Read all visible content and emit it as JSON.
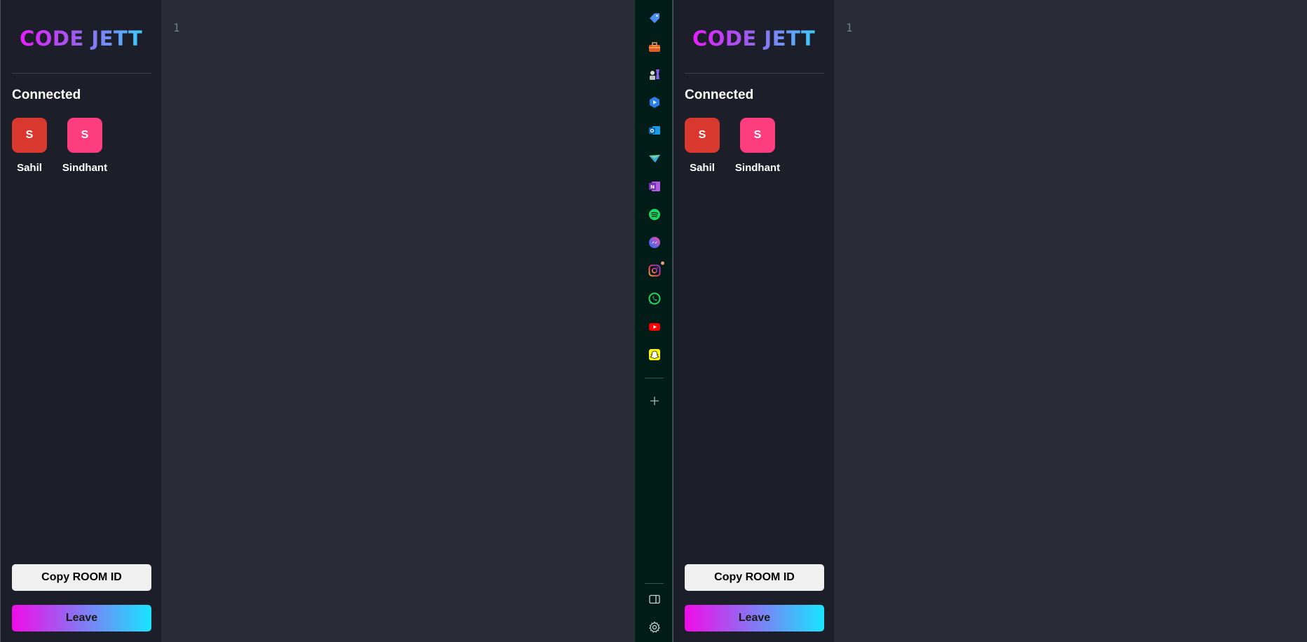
{
  "app": {
    "logo_text": "CODE JETT",
    "connected_label": "Connected",
    "clients": [
      {
        "initial": "S",
        "name": "Sahil",
        "color": "#d9382f"
      },
      {
        "initial": "S",
        "name": "Sindhant",
        "color": "#fe3d7e"
      }
    ],
    "copy_button": "Copy ROOM ID",
    "leave_button": "Leave",
    "line_number": "1",
    "brand_gradient": [
      "#e81cff",
      "#40c9ff"
    ]
  },
  "taskbar": {
    "icons": [
      "tag-icon",
      "toolbox-icon",
      "chess-icon",
      "copilot-icon",
      "outlook-icon",
      "send-anywhere-icon",
      "onenote-icon",
      "spotify-icon",
      "messenger-icon",
      "instagram-icon",
      "whatsapp-icon",
      "youtube-icon",
      "snapchat-icon",
      "add-icon",
      "sidebar-toggle-icon",
      "settings-icon"
    ]
  }
}
